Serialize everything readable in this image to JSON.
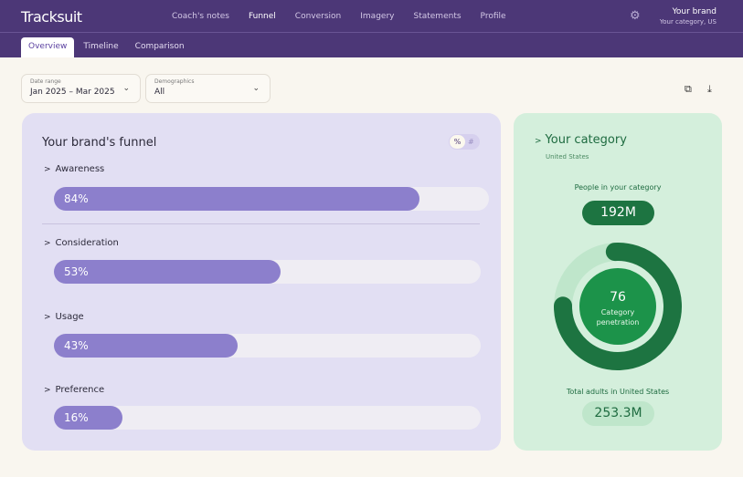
{
  "app": {
    "logo": "Tracksuit",
    "nav": [
      "Coach's notes",
      "Funnel",
      "Conversion",
      "Imagery",
      "Statements",
      "Profile"
    ],
    "active_nav": "Funnel",
    "brand": "Your brand",
    "brand_sub": "Your category, US"
  },
  "tabs": [
    "Overview",
    "Timeline",
    "Comparison"
  ],
  "filters": {
    "date_label": "Date range",
    "date_value": "Jan 2025 – Mar 2025",
    "demo_label": "Demographics",
    "demo_value": "All"
  },
  "funnel": {
    "title": "Your brand's funnel",
    "toggle_on": "%",
    "toggle_off": "#",
    "stages": [
      {
        "label": "Awareness",
        "value": 84,
        "text": "84%"
      },
      {
        "label": "Consideration",
        "value": 53,
        "text": "53%"
      },
      {
        "label": "Usage",
        "value": 43,
        "text": "43%"
      },
      {
        "label": "Preference",
        "value": 16,
        "text": "16%"
      }
    ]
  },
  "category": {
    "title": "Your category",
    "subtitle": "United States",
    "people_label": "People in your category",
    "people_value": "192M",
    "penetration": 76,
    "penetration_text": "76",
    "penetration_label": "Category penetration",
    "total_label": "Total adults in United States",
    "total_value": "253.3M"
  },
  "colors": {
    "header": "#4c3777",
    "bar": "#8c7fcc",
    "green_dark": "#1d7441",
    "green_mid": "#1c934a"
  }
}
